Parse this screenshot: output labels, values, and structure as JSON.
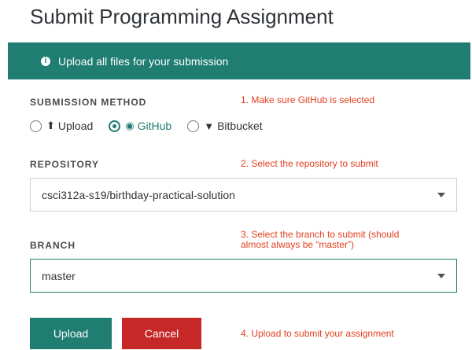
{
  "page": {
    "title": "Submit Programming Assignment"
  },
  "banner": {
    "icon": "info-icon",
    "text": "Upload all files for your submission"
  },
  "submission_method": {
    "label": "SUBMISSION METHOD",
    "note": "1. Make sure GitHub is selected",
    "options": [
      {
        "label": "Upload",
        "icon": "upload-icon",
        "selected": false
      },
      {
        "label": "GitHub",
        "icon": "github-icon",
        "selected": true
      },
      {
        "label": "Bitbucket",
        "icon": "bitbucket-icon",
        "selected": false
      }
    ]
  },
  "repository": {
    "label": "REPOSITORY",
    "note": "2. Select the repository to submit",
    "value": "csci312a-s19/birthday-practical-solution"
  },
  "branch": {
    "label": "BRANCH",
    "note_line1": "3. Select the branch to submit (should",
    "note_line2": "almost always be “master”)",
    "value": "master"
  },
  "actions": {
    "upload_label": "Upload",
    "cancel_label": "Cancel",
    "note": "4. Upload to submit your assignment"
  },
  "colors": {
    "accent": "#1f7d72",
    "danger": "#c62828",
    "annotation": "#e2401f"
  }
}
